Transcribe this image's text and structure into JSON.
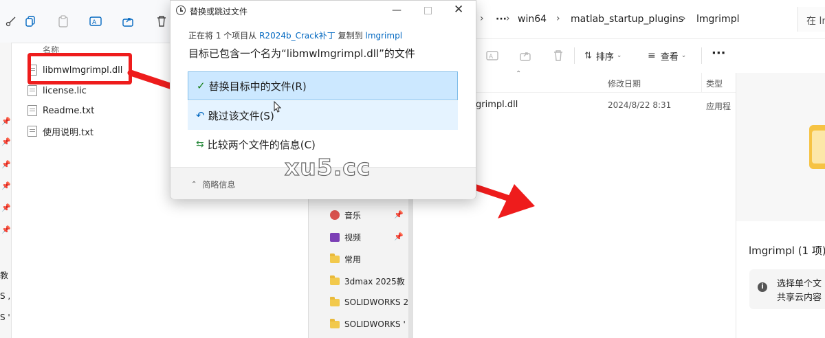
{
  "left_explorer": {
    "column_header": "名称",
    "files": [
      {
        "name": "libmwlmgrimpl.dll",
        "icon": "dll-file-icon"
      },
      {
        "name": "license.lic",
        "icon": "file-icon"
      },
      {
        "name": "Readme.txt",
        "icon": "text-file-icon"
      },
      {
        "name": "使用说明.txt",
        "icon": "text-file-icon"
      }
    ],
    "left_edge_labels": [
      "教",
      "S ,",
      "S '"
    ]
  },
  "dialog": {
    "title": "替换或跳过文件",
    "copy_line_prefix": "正在将 1 个项目从",
    "source": "R2024b_Crack补丁",
    "copy_line_mid": "复制到",
    "destination": "lmgrimpl",
    "message": "目标已包含一个名为“libmwlmgrimpl.dll”的文件",
    "options": [
      {
        "label": "替换目标中的文件(R)",
        "icon": "checkmark-icon"
      },
      {
        "label": "跳过该文件(S)",
        "icon": "skip-arrow-icon"
      },
      {
        "label": "比较两个文件的信息(C)",
        "icon": "compare-icon"
      }
    ],
    "brief_info": "简略信息"
  },
  "right_explorer": {
    "breadcrumbs": [
      "win64",
      "matlab_startup_plugins",
      "lmgrimpl"
    ],
    "search_placeholder": "在 lm",
    "sort_label": "排序",
    "view_label": "查看",
    "columns": {
      "modified": "修改日期",
      "type": "类型"
    },
    "file_row": {
      "name": "grimpl.dll",
      "date": "2024/8/22 8:31",
      "type": "应用程"
    },
    "details_title": "lmgrimpl (1 项)",
    "details_info_line1": "选择单个文",
    "details_info_line2": "共享云内容"
  },
  "middle_nav": [
    {
      "label": "音乐",
      "icon": "music-icon",
      "pinned": true
    },
    {
      "label": "视频",
      "icon": "video-icon",
      "pinned": true
    },
    {
      "label": "常用",
      "icon": "folder-icon"
    },
    {
      "label": "3dmax 2025教",
      "icon": "folder-icon"
    },
    {
      "label": "SOLIDWORKS 2",
      "icon": "folder-icon"
    },
    {
      "label": "SOLIDWORKS '",
      "icon": "folder-icon"
    }
  ],
  "watermark": "xu5.cc",
  "colors": {
    "accent": "#0067c0",
    "highlight_red": "#ee1c1c",
    "option_selected": "#cce8ff",
    "option_hover": "#e5f3ff"
  }
}
